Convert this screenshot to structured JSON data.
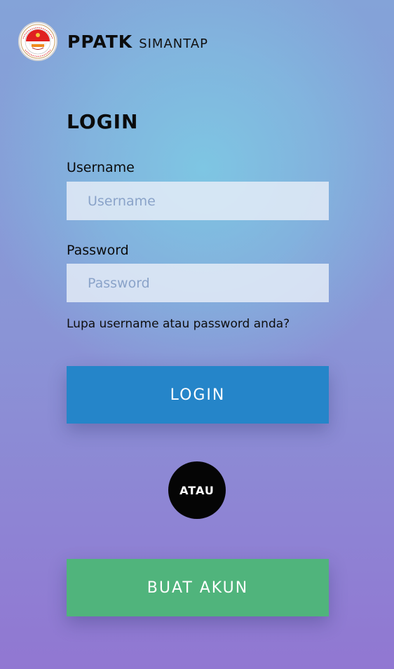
{
  "header": {
    "brand_main": "PPATK",
    "brand_sub": "SIMANTAP"
  },
  "login": {
    "title": "LOGIN",
    "username_label": "Username",
    "username_placeholder": "Username",
    "username_value": "",
    "password_label": "Password",
    "password_placeholder": "Password",
    "password_value": "",
    "forgot_link": "Lupa username atau password anda?",
    "login_button": "LOGIN",
    "or_label": "ATAU",
    "register_button": "BUAT AKUN"
  },
  "colors": {
    "login_button": "#2585c9",
    "register_button": "#50b47c",
    "or_circle": "#050505"
  },
  "icons": {
    "logo": "ppatk-seal-logo"
  }
}
